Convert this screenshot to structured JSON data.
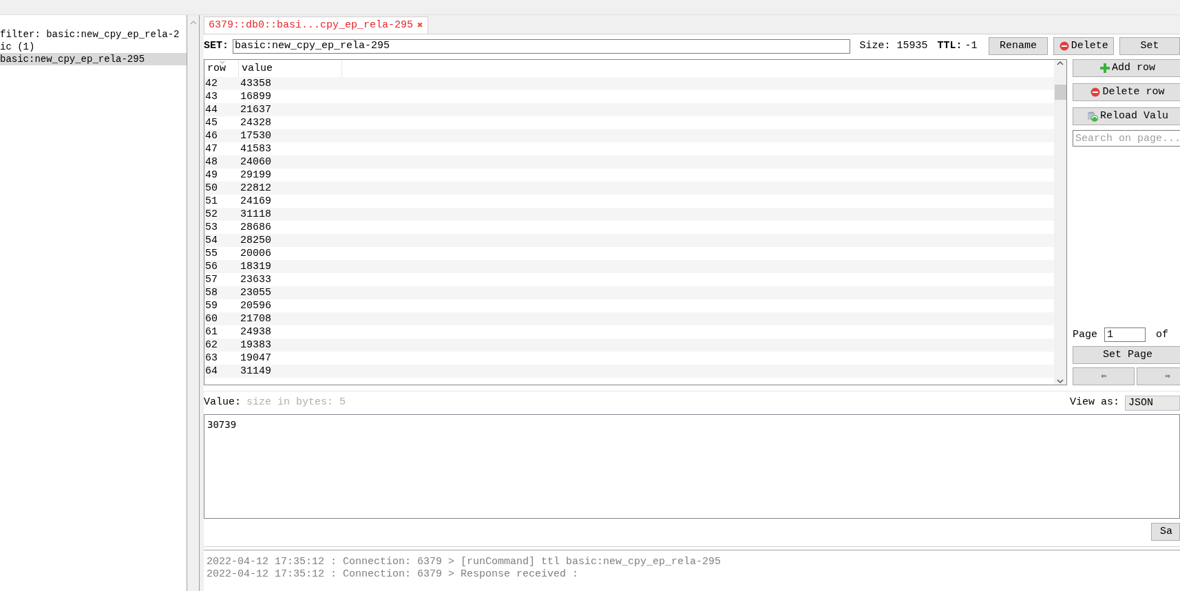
{
  "sidebar": {
    "filter": "filter: basic:new_cpy_ep_rela-2",
    "tree": [
      {
        "label": "ic (1)",
        "selected": false,
        "children": [
          {
            "label": "basic:new_cpy_ep_rela-295",
            "selected": true
          }
        ]
      }
    ]
  },
  "tabs": [
    {
      "label": "6379::db0::basi...cpy_ep_rela-295",
      "selected": true,
      "close": "✖"
    }
  ],
  "key_bar": {
    "type_label": "SET:",
    "key": "basic:new_cpy_ep_rela-295",
    "size": "Size: 15935",
    "ttl_label": "TTL:",
    "ttl": "-1",
    "buttons": [
      "Rename",
      "Delete",
      "Set"
    ]
  },
  "table": {
    "columns": [
      "row",
      "value"
    ],
    "rows": [
      [
        "42",
        "43358"
      ],
      [
        "43",
        "16899"
      ],
      [
        "44",
        "21637"
      ],
      [
        "45",
        "24328"
      ],
      [
        "46",
        "17530"
      ],
      [
        "47",
        "41583"
      ],
      [
        "48",
        "24060"
      ],
      [
        "49",
        "29199"
      ],
      [
        "50",
        "22812"
      ],
      [
        "51",
        "24169"
      ],
      [
        "52",
        "31118"
      ],
      [
        "53",
        "28686"
      ],
      [
        "54",
        "28250"
      ],
      [
        "55",
        "20006"
      ],
      [
        "56",
        "18319"
      ],
      [
        "57",
        "23633"
      ],
      [
        "58",
        "23055"
      ],
      [
        "59",
        "20596"
      ],
      [
        "60",
        "21708"
      ],
      [
        "61",
        "24938"
      ],
      [
        "62",
        "19383"
      ],
      [
        "63",
        "19047"
      ],
      [
        "64",
        "31149"
      ]
    ]
  },
  "side_buttons": [
    {
      "label": "Add row",
      "kind": "add"
    },
    {
      "label": "Delete row",
      "kind": "delete"
    },
    {
      "label": "Reload Valu",
      "kind": "reload"
    }
  ],
  "search": {
    "placeholder": "Search on page..."
  },
  "pager": {
    "label": "Page",
    "value": "1",
    "of": "of",
    "set_button": "Set Page",
    "prev": "⇦",
    "next": "⇨"
  },
  "value": {
    "label": "Value:",
    "hint": "size in bytes: 5",
    "view_as": "View as:",
    "format": "JSON",
    "content": "30739",
    "save_button": "Sa"
  },
  "log": [
    "2022-04-12 17:35:12 : Connection: 6379 > [runCommand] ttl basic:new_cpy_ep_rela-295",
    "2022-04-12 17:35:12 : Connection: 6379 > Response received :"
  ]
}
